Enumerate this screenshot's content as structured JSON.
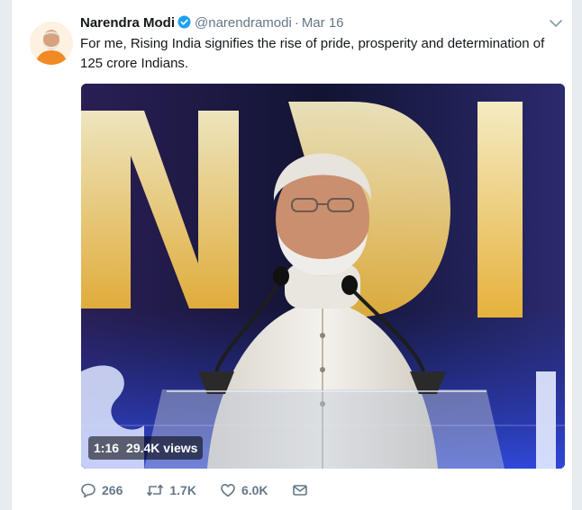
{
  "tweet": {
    "author": {
      "name": "Narendra Modi",
      "handle": "@narendramodi",
      "verified": true,
      "avatar_icon": "avatar-photo"
    },
    "separator": "·",
    "date": "Mar 16",
    "text": "For me, Rising India signifies the rise of pride, prosperity and determination of 125 crore Indians.",
    "media": {
      "type": "video",
      "duration": "1:16",
      "views": "29.4K views",
      "backdrop_letters_top": "NDI",
      "backdrop_letters_bottom": "S I"
    },
    "actions": {
      "reply_count": "266",
      "retweet_count": "1.7K",
      "like_count": "6.0K",
      "icons": [
        "reply-icon",
        "retweet-icon",
        "like-icon",
        "direct-message-icon"
      ]
    }
  },
  "colors": {
    "text": "#14171a",
    "secondary": "#657786",
    "verified": "#1da1f2",
    "border": "#e1e8ed",
    "stage_gold": "#f6d24a"
  }
}
